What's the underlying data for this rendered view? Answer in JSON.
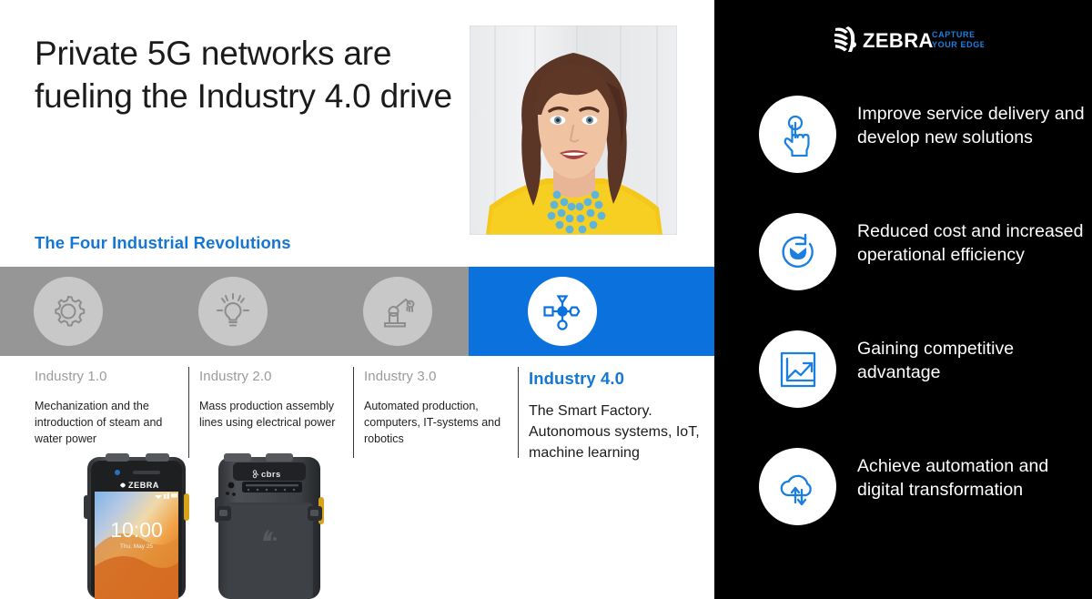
{
  "slide": {
    "title": "Private 5G networks are fueling the Industry 4.0 drive",
    "section_title": "The Four Industrial Revolutions",
    "accent_blue": "#1577d4",
    "band_blue": "#0b72dd",
    "band_gray": "#969696",
    "panel_black": "#000000"
  },
  "headshot": {
    "alt_name": "speaker-headshot"
  },
  "timeline": {
    "steps": [
      {
        "icon": "gear-icon",
        "era": "Industry 1.0",
        "desc": "Mechanization and the introduction of steam and water power",
        "active": false
      },
      {
        "icon": "lightbulb-icon",
        "era": "Industry 2.0",
        "desc": "Mass production assembly lines using electrical power",
        "active": false
      },
      {
        "icon": "robot-arm-icon",
        "era": "Industry 3.0",
        "desc": "Automated production, computers, IT-systems and robotics",
        "active": false
      },
      {
        "icon": "network-nodes-icon",
        "era": "Industry 4.0",
        "desc": "The Smart Factory. Autonomous systems, IoT, machine learning",
        "active": true
      }
    ]
  },
  "devices": {
    "front": {
      "brand": "ZEBRA",
      "clock": "10:00",
      "date": "Thu, May 25"
    },
    "back": {
      "badge": "cbrs",
      "brand_mark": "zebra-head-icon"
    }
  },
  "panel": {
    "logo": {
      "wordmark": "ZEBRA",
      "tagline_line1": "CAPTURE",
      "tagline_line2": "YOUR EDGE"
    },
    "benefits": [
      {
        "icon": "touch-finger-icon",
        "text": "Improve service delivery and develop new solutions"
      },
      {
        "icon": "cost-cycle-icon",
        "text": "Reduced cost and increased operational efficiency"
      },
      {
        "icon": "growth-chart-icon",
        "text": "Gaining competitive advantage"
      },
      {
        "icon": "cloud-sync-icon",
        "text": "Achieve automation and digital transformation"
      }
    ]
  }
}
